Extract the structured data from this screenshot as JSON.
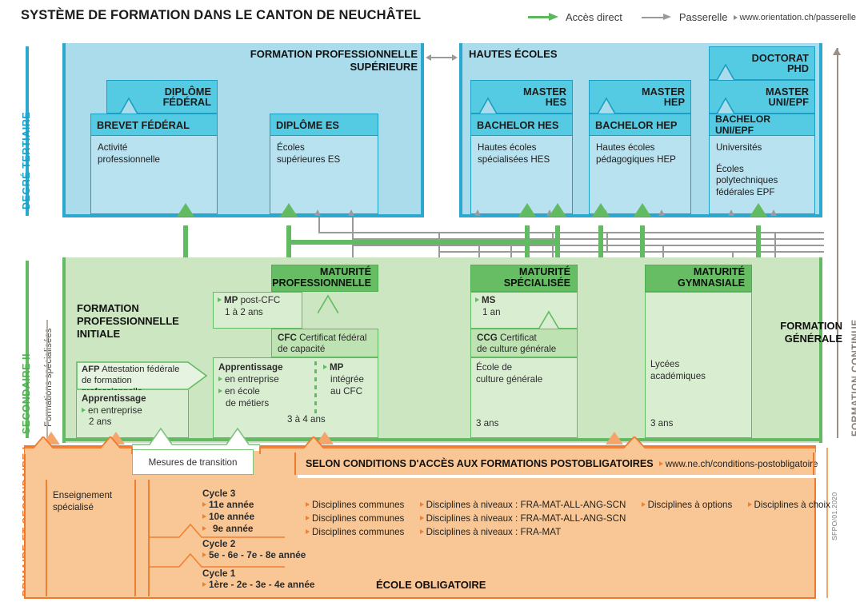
{
  "title": "SYSTÈME DE FORMATION DANS LE CANTON DE NEUCHÂTEL",
  "legend": {
    "direct_label": "Accès direct",
    "bridge_label": "Passerelle",
    "bridge_url": "www.orientation.ch/passerelle"
  },
  "side_labels": {
    "tertiary": "DEGRÉ TERTIAIRE",
    "secondary2": "SECONDAIRE II",
    "primary_sec1": "PRIMAIRE ET SECONDAIRE I",
    "specialised": "Formations spécialisées",
    "continuing": "FORMATION CONTINUE",
    "credit": "SFPO/01.2020"
  },
  "colors": {
    "tertiary_band": "#aadcec",
    "tertiary_head": "#55cbe3",
    "tertiary_border": "#1b9fc4",
    "sec2_band": "#cbe6c1",
    "sec2_head": "#66bd63",
    "sec2_border": "#62bb62",
    "orange_band": "#f9c795",
    "orange_border": "#ef7a2e",
    "green_arrow": "#5cb85c",
    "gray_arrow": "#9a9a9a"
  },
  "tertiary": {
    "group_pro_title_l1": "FORMATION PROFESSIONNELLE",
    "group_pro_title_l2": "SUPÉRIEURE",
    "group_hautes_title": "HAUTES ÉCOLES",
    "cards": {
      "brevet": {
        "top_l1": "DIPLÔME",
        "top_l2": "FÉDÉRAL",
        "head": "BREVET FÉDÉRAL",
        "body_l1": "Activité",
        "body_l2": "professionnelle"
      },
      "es": {
        "head": "DIPLÔME ES",
        "body_l1": "Écoles",
        "body_l2": "supérieures ES"
      },
      "hes": {
        "top_l1": "MASTER",
        "top_l2": "HES",
        "head": "BACHELOR HES",
        "body_l1": "Hautes écoles",
        "body_l2": "spécialisées HES"
      },
      "hep": {
        "top_l1": "MASTER",
        "top_l2": "HEP",
        "head": "BACHELOR HEP",
        "body_l1": "Hautes écoles",
        "body_l2": "pédagogiques HEP"
      },
      "uni": {
        "doctorat_l1": "DOCTORAT",
        "doctorat_l2": "PHD",
        "top_l1": "MASTER",
        "top_l2": "UNI/EPF",
        "head": "BACHELOR UNI/EPF",
        "body_l1": "Universités",
        "body_l2": "Écoles polytechniques",
        "body_l3": "fédérales EPF"
      }
    }
  },
  "secondary2": {
    "fpi_l1": "FORMATION",
    "fpi_l2": "PROFESSIONNELLE",
    "fpi_l3": "INITIALE",
    "fg_l1": "FORMATION",
    "fg_l2": "GÉNÉRALE",
    "afp": {
      "bold": "AFP",
      "rest_l1": "Attestation fédérale",
      "rest_l2": "de formation professionnelle",
      "app_title": "Apprentissage",
      "app_l1": "en entreprise",
      "app_dur": "2 ans"
    },
    "mp": {
      "head_l1": "MATURITÉ",
      "head_l2": "PROFESSIONNELLE",
      "post_cfc": "MP",
      "post_cfc_rest": "post-CFC",
      "post_cfc_dur": "1 à 2 ans",
      "cfc_bold": "CFC",
      "cfc_l1": "Certificat fédéral",
      "cfc_l2": "de capacité",
      "app_title": "Apprentissage",
      "app_l1": "en entreprise",
      "app_l2": "en école",
      "app_l3": "de métiers",
      "app_dur": "3 à 4 ans",
      "mp_int_bold": "MP",
      "mp_int_l1": "intégrée",
      "mp_int_l2": "au CFC"
    },
    "ms": {
      "head_l1": "MATURITÉ",
      "head_l2": "SPÉCIALISÉE",
      "ms_bold": "MS",
      "ms_dur": "1 an",
      "ccg_bold": "CCG",
      "ccg_l1": "Certificat",
      "ccg_l2": "de culture générale",
      "body_l1": "École de",
      "body_l2": "culture générale",
      "dur": "3 ans"
    },
    "gym": {
      "head_l1": "MATURITÉ",
      "head_l2": "GYMNASIALE",
      "body_l1": "Lycées",
      "body_l2": "académiques",
      "dur": "3 ans"
    }
  },
  "primary": {
    "transition": "Mesures de transition",
    "conditions_bold": "SELON CONDITIONS D'ACCÈS AUX FORMATIONS POSTOBLIGATOIRES",
    "conditions_url": "www.ne.ch/conditions-postobligatoire",
    "special_l1": "Enseignement",
    "special_l2": "spécialisé",
    "cycle3_title": "Cycle 3",
    "cycle3_years": [
      "11e année",
      "10e année",
      "9e année"
    ],
    "cycle2_title": "Cycle 2",
    "cycle2_years": "5e - 6e - 7e - 8e année",
    "cycle1_title": "Cycle 1",
    "cycle1_years": "1ère - 2e - 3e - 4e année",
    "disciplines": {
      "row1": [
        "Disciplines communes",
        "Disciplines à niveaux : FRA-MAT-ALL-ANG-SCN",
        "Disciplines à options",
        "Disciplines à choix"
      ],
      "row2": [
        "Disciplines communes",
        "Disciplines à niveaux : FRA-MAT-ALL-ANG-SCN"
      ],
      "row3": [
        "Disciplines communes",
        "Disciplines à niveaux : FRA-MAT"
      ]
    },
    "school_label": "ÉCOLE OBLIGATOIRE"
  }
}
